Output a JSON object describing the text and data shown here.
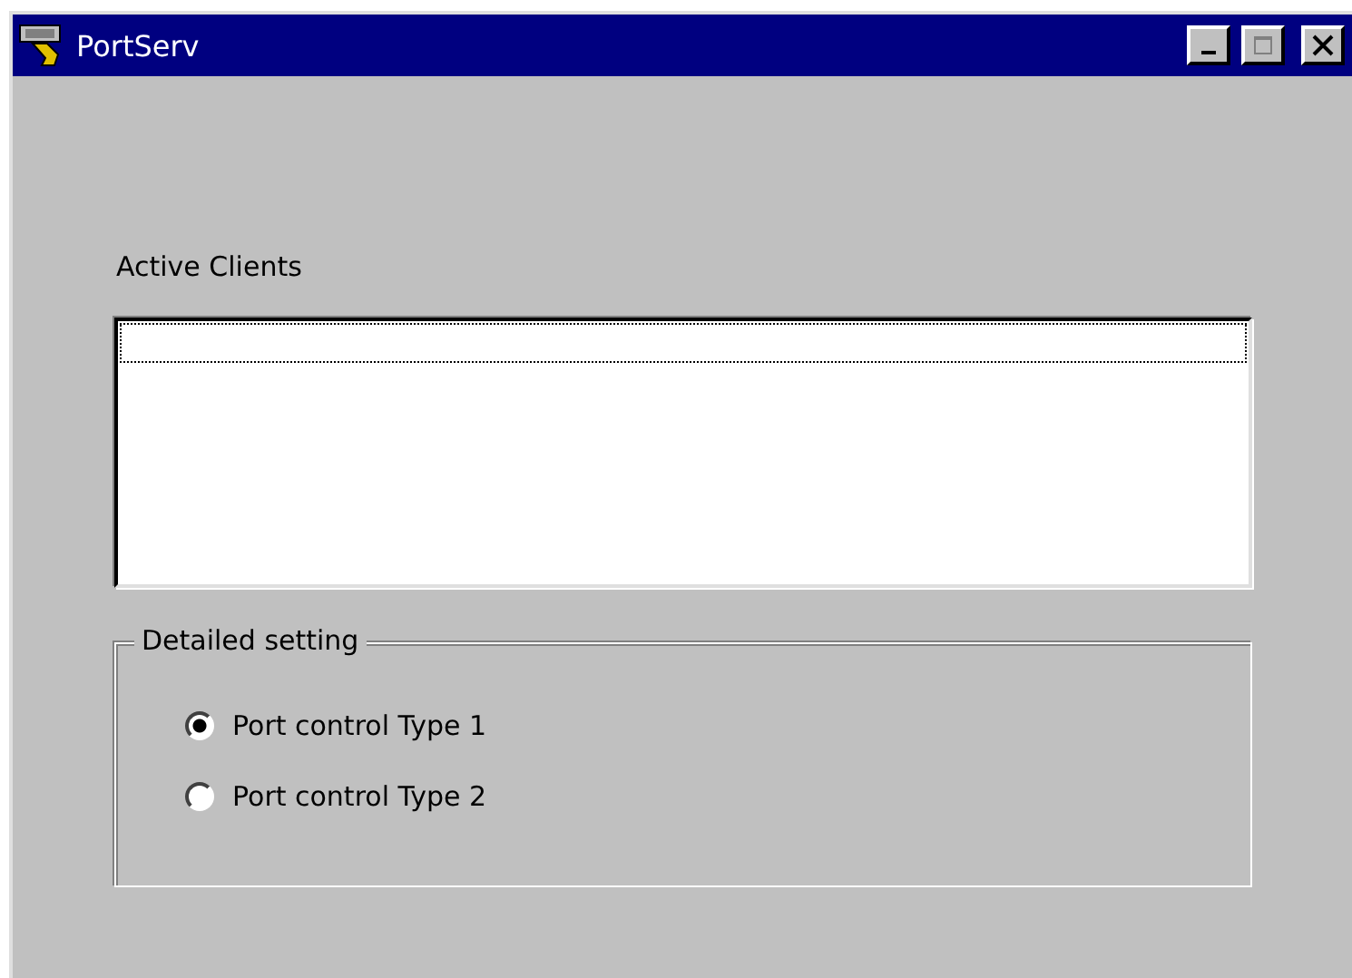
{
  "window": {
    "title": "PortServ"
  },
  "clients": {
    "label": "Active Clients"
  },
  "group": {
    "title": "Detailed setting",
    "options": [
      {
        "label": "Port control Type 1",
        "selected": true
      },
      {
        "label": "Port control Type 2",
        "selected": false
      }
    ]
  }
}
